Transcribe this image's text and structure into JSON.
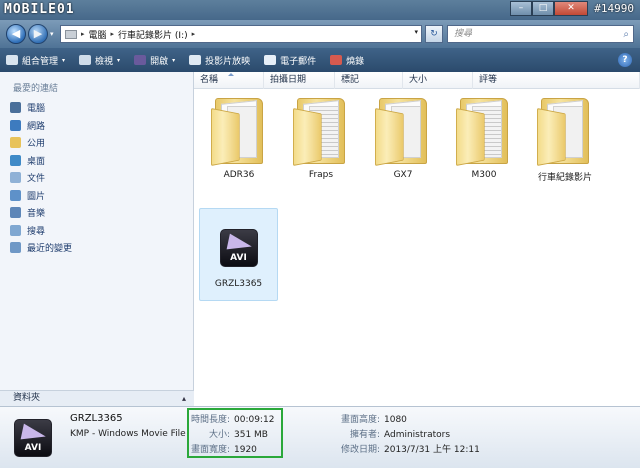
{
  "titlebar": {
    "watermark": "MOBILE01",
    "watermark_id": "#14990",
    "buttons": [
      "–",
      "□",
      "✕"
    ]
  },
  "nav": {
    "back": "◀",
    "forward": "▶",
    "dropdown": "▾"
  },
  "address": {
    "crumbs": [
      "電腦",
      "行車記錄影片 (I:)"
    ],
    "separator": "▸",
    "dropdown": "▾"
  },
  "refresh_glyph": "↻",
  "search": {
    "placeholder": "搜尋",
    "icon": "⌕"
  },
  "toolbar": {
    "items": [
      {
        "label": "組合管理",
        "icon": "organize-icon",
        "color": "#d9e4ef",
        "arrow": "▾"
      },
      {
        "label": "檢視",
        "icon": "views-icon",
        "color": "#cfdcea",
        "arrow": "▾"
      },
      {
        "label": "開啟",
        "icon": "kmp-icon",
        "color": "#6a5a9c",
        "arrow": "▾"
      },
      {
        "label": "投影片放映",
        "icon": "slideshow-icon",
        "color": "#dfe9f3",
        "arrow": ""
      },
      {
        "label": "電子郵件",
        "icon": "email-icon",
        "color": "#e6eef7",
        "arrow": ""
      },
      {
        "label": "燒錄",
        "icon": "burn-icon",
        "color": "#d65a4f",
        "arrow": ""
      }
    ],
    "help": "?"
  },
  "leftnav": {
    "title": "最愛的連結",
    "items": [
      {
        "label": "電腦",
        "icon": "computer-icon",
        "color": "#4a6f9a"
      },
      {
        "label": "網路",
        "icon": "network-icon",
        "color": "#3d7bbf"
      },
      {
        "label": "公用",
        "icon": "public-folder-icon",
        "color": "#e8c35a"
      },
      {
        "label": "桌面",
        "icon": "desktop-icon",
        "color": "#3f8ac7"
      },
      {
        "label": "文件",
        "icon": "documents-icon",
        "color": "#8fb1d6"
      },
      {
        "label": "圖片",
        "icon": "pictures-icon",
        "color": "#5e91c9"
      },
      {
        "label": "音樂",
        "icon": "music-icon",
        "color": "#5d86b8"
      },
      {
        "label": "搜尋",
        "icon": "search-icon",
        "color": "#7fa7d1"
      },
      {
        "label": "最近的變更",
        "icon": "recent-icon",
        "color": "#6f98c6"
      }
    ],
    "folders_label": "資料夾",
    "folders_chevron": "▴"
  },
  "columns": [
    "名稱",
    "拍攝日期",
    "標記",
    "大小",
    "評等"
  ],
  "folders": [
    {
      "label": "ADR36",
      "striped": false
    },
    {
      "label": "Fraps",
      "striped": true
    },
    {
      "label": "GX7",
      "striped": false
    },
    {
      "label": "M300",
      "striped": true
    },
    {
      "label": "行車紀錄影片",
      "striped": false
    }
  ],
  "file": {
    "label": "GRZL3365",
    "icon_text": "AVI"
  },
  "details": {
    "name": "GRZL3365",
    "type": "KMP - Windows Movie File",
    "icon_text": "AVI",
    "props_left": [
      {
        "k": "時間長度:",
        "v": "00:09:12"
      },
      {
        "k": "大小:",
        "v": "351 MB"
      },
      {
        "k": "畫面寬度:",
        "v": "1920"
      }
    ],
    "props_right": [
      {
        "k": "畫面高度:",
        "v": "1080"
      },
      {
        "k": "擁有者:",
        "v": "Administrators"
      },
      {
        "k": "修改日期:",
        "v": "2013/7/31 上午 12:11"
      }
    ]
  },
  "colors": {
    "highlight": "#2aa83a",
    "selected_tile": "#dff0fd"
  }
}
